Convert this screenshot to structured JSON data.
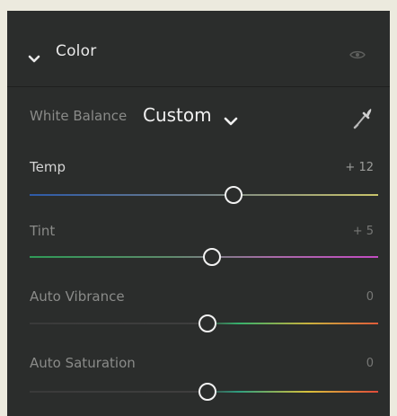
{
  "section": {
    "title": "Color"
  },
  "white_balance": {
    "label": "White Balance",
    "value": "Custom"
  },
  "sliders": [
    {
      "label": "Temp",
      "value": "+ 12",
      "level": 0.586
    },
    {
      "label": "Tint",
      "value": "+ 5",
      "level": 0.524
    },
    {
      "label": "Auto Vibrance",
      "value": "0",
      "level": 0.51
    },
    {
      "label": "Auto Saturation",
      "value": "0",
      "level": 0.51
    }
  ],
  "icons": {
    "section_toggle": "chevron-down-icon",
    "visibility": "eye-icon",
    "wb_dropdown": "chevron-down-icon",
    "eyedropper": "eyedropper-icon"
  },
  "colors": {
    "panel_bg": "#2b2d2c",
    "page_bg": "#eceade",
    "knob": "#f2f2f2",
    "temp_gradient": [
      "#2d5aa8",
      "#c9c46a"
    ],
    "tint_gradient": [
      "#2f9a57",
      "#c24bc2"
    ],
    "vibrance_gradient": [
      "#3a3a3a",
      "#36b06c",
      "#e05c3a"
    ],
    "saturation_gradient": [
      "#3a3a3a",
      "#2f9e7f",
      "#d8c03b",
      "#e04a3a"
    ]
  }
}
